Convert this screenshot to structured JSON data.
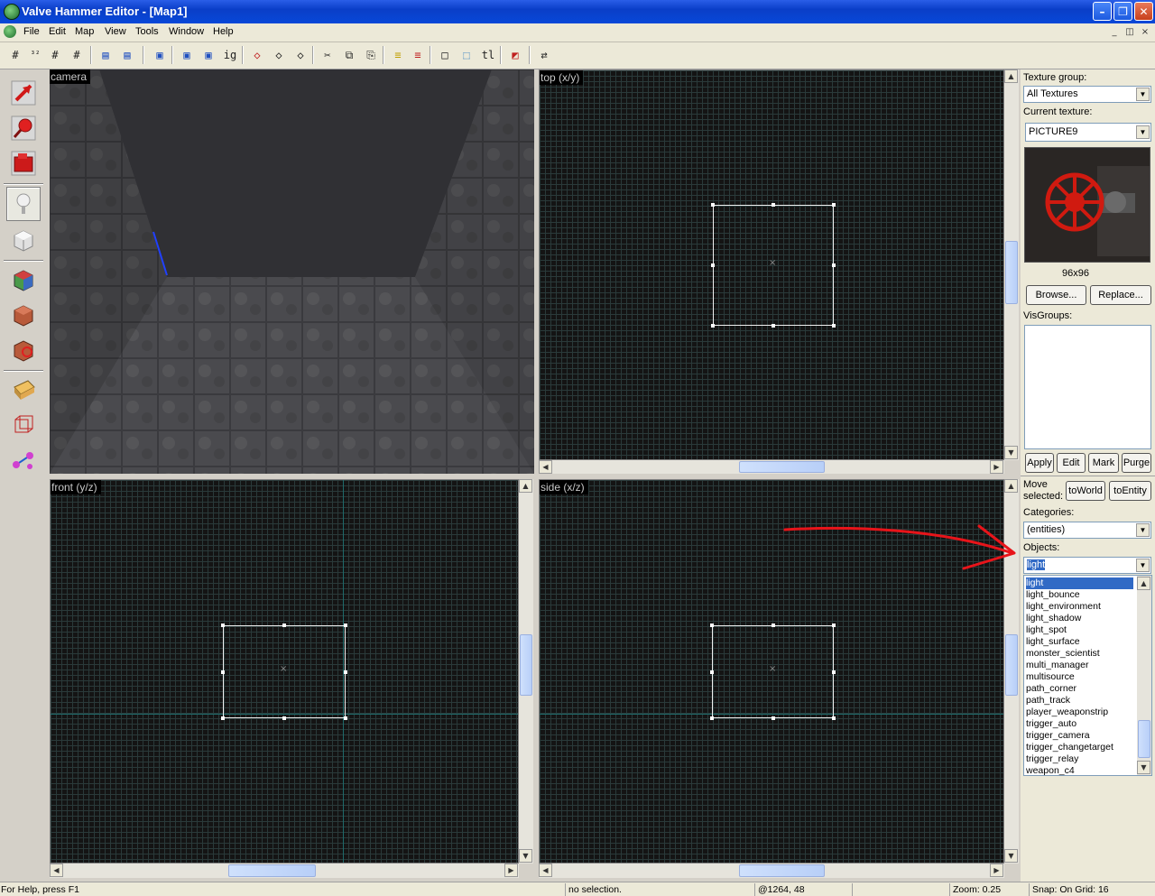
{
  "window": {
    "title": "Valve Hammer Editor - [Map1]",
    "min_glyph": "–",
    "max_glyph": "❐",
    "close_glyph": "✕"
  },
  "menu": {
    "items": [
      "File",
      "Edit",
      "Map",
      "View",
      "Tools",
      "Window",
      "Help"
    ],
    "doc_min": "_",
    "doc_restore": "◫",
    "doc_close": "×"
  },
  "toolbar": {
    "buttons": [
      "#",
      "³²",
      "#",
      "#",
      "▤",
      "▤",
      "▣",
      "▣",
      "▣",
      "ig",
      "◇",
      "◇",
      "◇",
      "✂",
      "⧉",
      "⎘",
      "≡",
      "≡",
      "□",
      "⬚",
      "tl",
      "◩",
      "⇄"
    ]
  },
  "tools": {
    "icons": [
      "pointer-tool-icon",
      "magnify-tool-icon",
      "camera-tool-icon",
      "entity-tool-icon",
      "block-tool-icon",
      "texture-tool-icon",
      "apply-texture-icon",
      "decal-tool-icon",
      "clipping-tool-icon",
      "vertex-tool-icon",
      "path-tool-icon"
    ],
    "active_index": 3
  },
  "views": {
    "camera": "camera",
    "top": "top (x/y)",
    "front": "front (y/z)",
    "side": "side (x/z)",
    "grid_color": "#2a3a3a",
    "axis_color": "#1e6a6a",
    "brush_color": "#f0f0f0",
    "scroll_up": "▲",
    "scroll_down": "▼",
    "scroll_left": "◀",
    "scroll_right": "▶",
    "center_mark": "×"
  },
  "texture": {
    "group_label": "Texture group:",
    "group_value": "All Textures",
    "current_label": "Current texture:",
    "current_value": "PICTURE9",
    "size": "96x96",
    "browse": "Browse...",
    "replace": "Replace..."
  },
  "visgroups": {
    "label": "VisGroups:",
    "apply": "Apply",
    "edit": "Edit",
    "mark": "Mark",
    "purge": "Purge"
  },
  "move": {
    "label_line1": "Move",
    "label_line2": "selected:",
    "to_world": "toWorld",
    "to_entity": "toEntity"
  },
  "categories": {
    "label": "Categories:",
    "value": "(entities)"
  },
  "objects": {
    "label": "Objects:",
    "value": "light",
    "list": [
      "light",
      "light_bounce",
      "light_environment",
      "light_shadow",
      "light_spot",
      "light_surface",
      "monster_scientist",
      "multi_manager",
      "multisource",
      "path_corner",
      "path_track",
      "player_weaponstrip",
      "trigger_auto",
      "trigger_camera",
      "trigger_changetarget",
      "trigger_relay",
      "weapon_c4"
    ],
    "selected_index": 0,
    "annotation_color": "#e8141a"
  },
  "status": {
    "help": "For Help, press F1",
    "selection": "no selection.",
    "coords": "@1264, 48",
    "zoom": "Zoom: 0.25",
    "snap": "Snap: On Grid: 16"
  }
}
